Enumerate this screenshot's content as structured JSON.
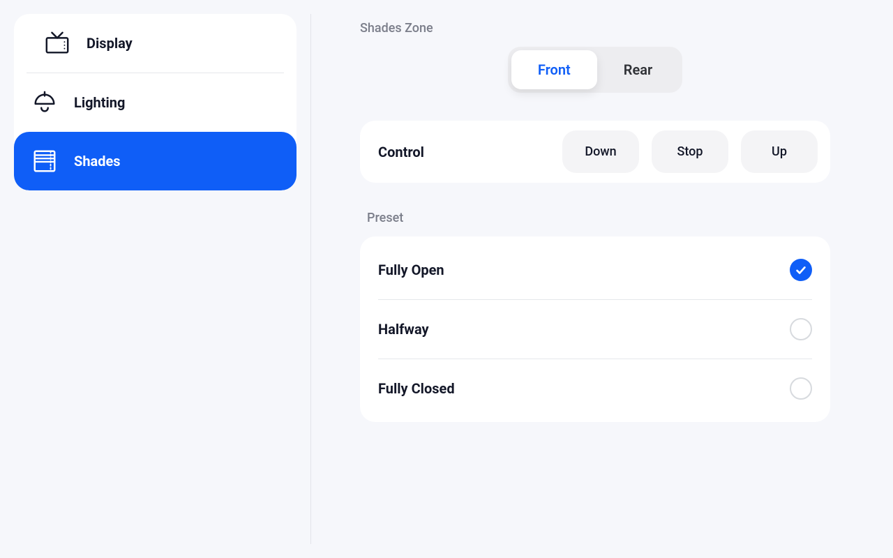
{
  "sidebar": {
    "items": [
      {
        "label": "Display",
        "active": false
      },
      {
        "label": "Lighting",
        "active": false
      },
      {
        "label": "Shades",
        "active": true
      }
    ]
  },
  "main": {
    "zone": {
      "label": "Shades Zone",
      "tabs": [
        {
          "label": "Front",
          "active": true
        },
        {
          "label": "Rear",
          "active": false
        }
      ]
    },
    "control": {
      "label": "Control",
      "buttons": [
        {
          "label": "Down"
        },
        {
          "label": "Stop"
        },
        {
          "label": "Up"
        }
      ]
    },
    "preset": {
      "label": "Preset",
      "options": [
        {
          "label": "Fully Open",
          "selected": true
        },
        {
          "label": "Halfway",
          "selected": false
        },
        {
          "label": "Fully Closed",
          "selected": false
        }
      ]
    }
  }
}
